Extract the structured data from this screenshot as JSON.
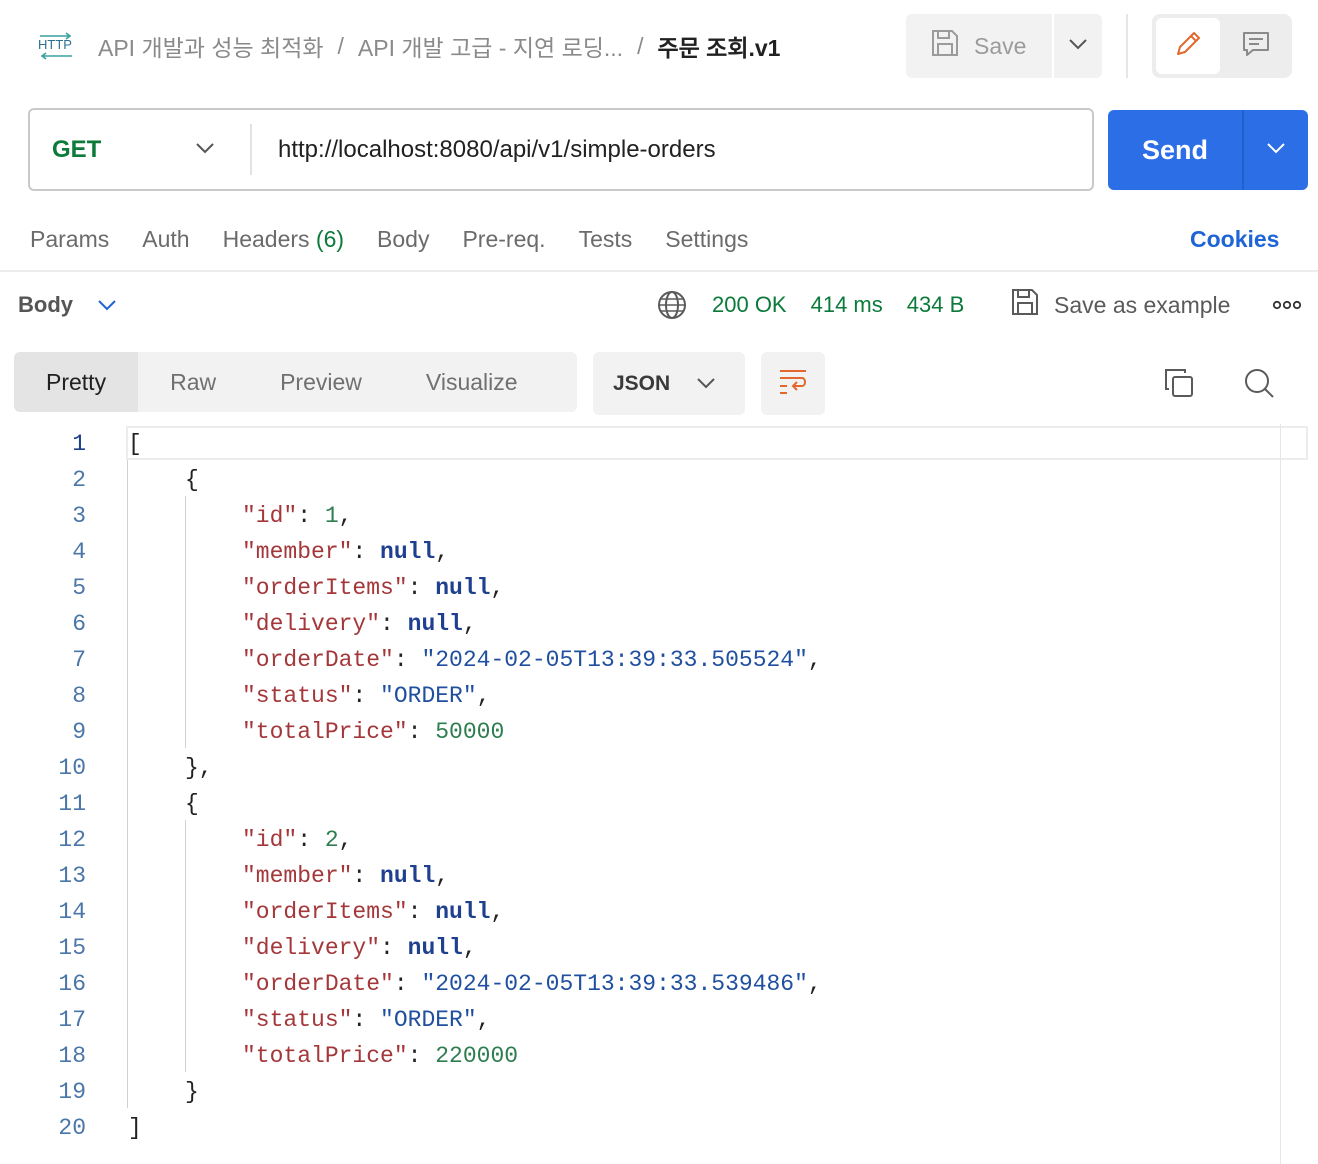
{
  "breadcrumb": {
    "icon_label": "HTTP",
    "items": [
      "API 개발과 성능 최적화",
      "API 개발 고급 - 지연 로딩..."
    ],
    "current": "주문 조회.v1"
  },
  "toolbar": {
    "save_label": "Save"
  },
  "request": {
    "method": "GET",
    "url": "http://localhost:8080/api/v1/simple-orders",
    "send_label": "Send"
  },
  "request_tabs": {
    "params": "Params",
    "auth": "Auth",
    "headers": "Headers",
    "headers_count": "(6)",
    "body": "Body",
    "prereq": "Pre-req.",
    "tests": "Tests",
    "settings": "Settings",
    "cookies": "Cookies"
  },
  "response": {
    "section_label": "Body",
    "status": "200 OK",
    "time": "414 ms",
    "size": "434 B",
    "save_example_label": "Save as example"
  },
  "view": {
    "tabs": [
      "Pretty",
      "Raw",
      "Preview",
      "Visualize"
    ],
    "active_tab": "Pretty",
    "format": "JSON"
  },
  "code_lines": [
    {
      "n": "1",
      "text": "["
    },
    {
      "n": "2",
      "text": "{"
    },
    {
      "n": "3",
      "key": "\"id\"",
      "value": "1",
      "type": "number",
      "comma": ","
    },
    {
      "n": "4",
      "key": "\"member\"",
      "value": "null",
      "type": "null",
      "comma": ","
    },
    {
      "n": "5",
      "key": "\"orderItems\"",
      "value": "null",
      "type": "null",
      "comma": ","
    },
    {
      "n": "6",
      "key": "\"delivery\"",
      "value": "null",
      "type": "null",
      "comma": ","
    },
    {
      "n": "7",
      "key": "\"orderDate\"",
      "value": "\"2024-02-05T13:39:33.505524\"",
      "type": "string",
      "comma": ","
    },
    {
      "n": "8",
      "key": "\"status\"",
      "value": "\"ORDER\"",
      "type": "string",
      "comma": ","
    },
    {
      "n": "9",
      "key": "\"totalPrice\"",
      "value": "50000",
      "type": "number",
      "comma": ""
    },
    {
      "n": "10",
      "text": "},"
    },
    {
      "n": "11",
      "text": "{"
    },
    {
      "n": "12",
      "key": "\"id\"",
      "value": "2",
      "type": "number",
      "comma": ","
    },
    {
      "n": "13",
      "key": "\"member\"",
      "value": "null",
      "type": "null",
      "comma": ","
    },
    {
      "n": "14",
      "key": "\"orderItems\"",
      "value": "null",
      "type": "null",
      "comma": ","
    },
    {
      "n": "15",
      "key": "\"delivery\"",
      "value": "null",
      "type": "null",
      "comma": ","
    },
    {
      "n": "16",
      "key": "\"orderDate\"",
      "value": "\"2024-02-05T13:39:33.539486\"",
      "type": "string",
      "comma": ","
    },
    {
      "n": "17",
      "key": "\"status\"",
      "value": "\"ORDER\"",
      "type": "string",
      "comma": ","
    },
    {
      "n": "18",
      "key": "\"totalPrice\"",
      "value": "220000",
      "type": "number",
      "comma": ""
    },
    {
      "n": "19",
      "text": "}"
    },
    {
      "n": "20",
      "text": "]"
    }
  ],
  "colors": {
    "accent": "#2b6ee6",
    "method_get": "#0b7a3a",
    "status_ok": "#0b7a3a",
    "json_key": "#a4373a",
    "json_string": "#1f4f9e",
    "json_number": "#2e7d4f",
    "json_null": "#1f3f8f",
    "edit_icon": "#e2682e"
  },
  "icons": {
    "http": "http-icon",
    "save": "floppy-icon",
    "edit": "pencil-icon",
    "comment": "comment-icon",
    "globe": "globe-icon",
    "save_example": "floppy-icon",
    "more": "more-icon",
    "wrap": "wrap-lines-icon",
    "copy": "copy-icon",
    "search": "search-icon"
  }
}
